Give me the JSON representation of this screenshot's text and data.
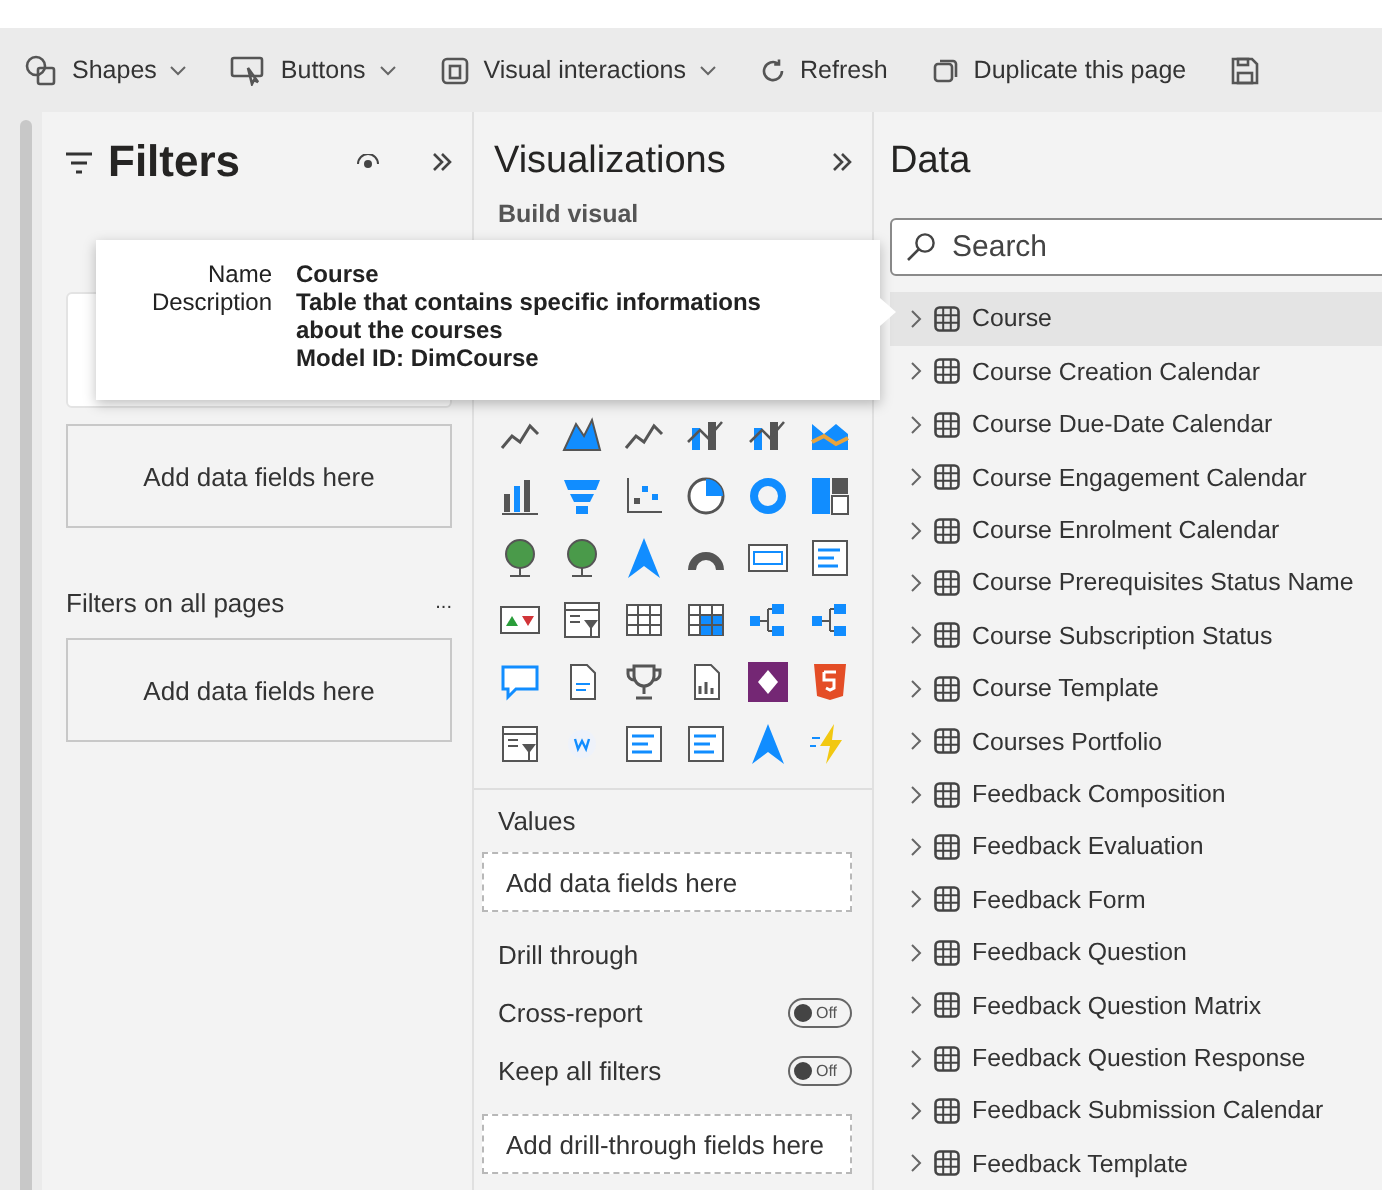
{
  "toolbar": [
    {
      "label": "Shapes",
      "kind": "shapes",
      "dropdown": true
    },
    {
      "label": "Buttons",
      "kind": "buttons",
      "dropdown": true
    },
    {
      "label": "Visual interactions",
      "kind": "interactions",
      "dropdown": true
    },
    {
      "label": "Refresh",
      "kind": "refresh",
      "dropdown": false
    },
    {
      "label": "Duplicate this page",
      "kind": "duplicate",
      "dropdown": false
    },
    {
      "kind": "save",
      "dropdown": false
    }
  ],
  "filters": {
    "title": "Filters",
    "page_zone": "Add data fields here",
    "all_pages": {
      "label": "Filters on all pages",
      "more": "...",
      "zone": "Add data fields here"
    }
  },
  "visualizations": {
    "title": "Visualizations",
    "subtitle": "Build visual",
    "values": {
      "label": "Values",
      "zone": "Add data fields here"
    },
    "drill_through": {
      "label": "Drill through",
      "toggles": [
        {
          "label": "Cross-report",
          "on": false,
          "state_text": "Off"
        },
        {
          "label": "Keep all filters",
          "on": false,
          "state_text": "Off"
        }
      ],
      "zone": "Add drill-through fields here"
    }
  },
  "data": {
    "title": "Data",
    "search": {
      "placeholder": "Search"
    },
    "tables": [
      {
        "name": "Course",
        "selected": true
      },
      {
        "name": "Course Creation Calendar",
        "selected": false
      },
      {
        "name": "Course Due-Date Calendar",
        "selected": false
      },
      {
        "name": "Course Engagement Calendar",
        "selected": false
      },
      {
        "name": "Course Enrolment Calendar",
        "selected": false
      },
      {
        "name": "Course Prerequisites Status Name",
        "selected": false
      },
      {
        "name": "Course Subscription Status",
        "selected": false
      },
      {
        "name": "Course Template",
        "selected": false
      },
      {
        "name": "Courses Portfolio",
        "selected": false
      },
      {
        "name": "Feedback Composition",
        "selected": false
      },
      {
        "name": "Feedback Evaluation",
        "selected": false
      },
      {
        "name": "Feedback Form",
        "selected": false
      },
      {
        "name": "Feedback Question",
        "selected": false
      },
      {
        "name": "Feedback Question Matrix",
        "selected": false
      },
      {
        "name": "Feedback Question Response",
        "selected": false
      },
      {
        "name": "Feedback Submission Calendar",
        "selected": false
      },
      {
        "name": "Feedback Template",
        "selected": false
      }
    ]
  },
  "tooltip": {
    "rows": [
      {
        "label": "Name",
        "value": "Course"
      },
      {
        "label": "Description",
        "value": "Table that contains specific informations about the courses"
      }
    ],
    "model_id": "Model ID: DimCourse"
  }
}
